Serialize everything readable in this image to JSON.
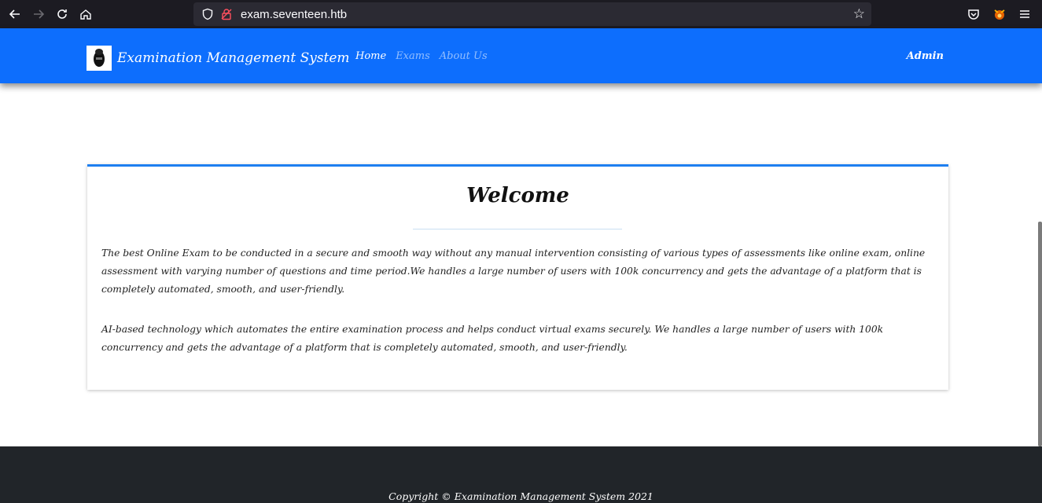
{
  "browser": {
    "url": "exam.seventeen.htb"
  },
  "navbar": {
    "brand": "Examination Management System",
    "links": [
      {
        "label": "Home"
      },
      {
        "label": "Exams"
      },
      {
        "label": "About Us"
      }
    ],
    "user": "Admin"
  },
  "welcome": {
    "title": "Welcome",
    "paragraphs": [
      "The best Online Exam to be conducted in a secure and smooth way without any manual intervention consisting of various types of assessments like online exam, online assessment with varying number of questions and time period.We handles a large number of users with 100k concurrency and gets the advantage of a platform that is completely automated, smooth, and user-friendly.",
      "AI-based technology which automates the entire examination process and helps conduct virtual exams securely. We handles a large number of users with 100k concurrency and gets the advantage of a platform that is completely automated, smooth, and user-friendly."
    ]
  },
  "footer": {
    "copyright": "Copyright © Examination Management System 2021"
  },
  "colors": {
    "navbar": "#0d6efd",
    "card_accent": "#1e7ff0",
    "footer": "#212529",
    "browser_chrome": "#1c1b22"
  }
}
